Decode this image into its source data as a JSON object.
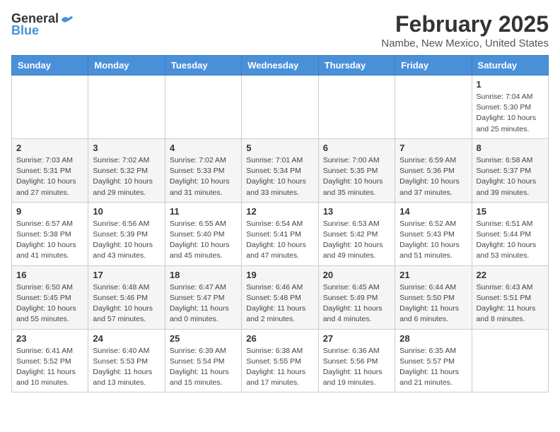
{
  "header": {
    "logo_general": "General",
    "logo_blue": "Blue",
    "title": "February 2025",
    "location": "Nambe, New Mexico, United States"
  },
  "days_of_week": [
    "Sunday",
    "Monday",
    "Tuesday",
    "Wednesday",
    "Thursday",
    "Friday",
    "Saturday"
  ],
  "weeks": [
    [
      {
        "day": "",
        "detail": ""
      },
      {
        "day": "",
        "detail": ""
      },
      {
        "day": "",
        "detail": ""
      },
      {
        "day": "",
        "detail": ""
      },
      {
        "day": "",
        "detail": ""
      },
      {
        "day": "",
        "detail": ""
      },
      {
        "day": "1",
        "detail": "Sunrise: 7:04 AM\nSunset: 5:30 PM\nDaylight: 10 hours\nand 25 minutes."
      }
    ],
    [
      {
        "day": "2",
        "detail": "Sunrise: 7:03 AM\nSunset: 5:31 PM\nDaylight: 10 hours\nand 27 minutes."
      },
      {
        "day": "3",
        "detail": "Sunrise: 7:02 AM\nSunset: 5:32 PM\nDaylight: 10 hours\nand 29 minutes."
      },
      {
        "day": "4",
        "detail": "Sunrise: 7:02 AM\nSunset: 5:33 PM\nDaylight: 10 hours\nand 31 minutes."
      },
      {
        "day": "5",
        "detail": "Sunrise: 7:01 AM\nSunset: 5:34 PM\nDaylight: 10 hours\nand 33 minutes."
      },
      {
        "day": "6",
        "detail": "Sunrise: 7:00 AM\nSunset: 5:35 PM\nDaylight: 10 hours\nand 35 minutes."
      },
      {
        "day": "7",
        "detail": "Sunrise: 6:59 AM\nSunset: 5:36 PM\nDaylight: 10 hours\nand 37 minutes."
      },
      {
        "day": "8",
        "detail": "Sunrise: 6:58 AM\nSunset: 5:37 PM\nDaylight: 10 hours\nand 39 minutes."
      }
    ],
    [
      {
        "day": "9",
        "detail": "Sunrise: 6:57 AM\nSunset: 5:38 PM\nDaylight: 10 hours\nand 41 minutes."
      },
      {
        "day": "10",
        "detail": "Sunrise: 6:56 AM\nSunset: 5:39 PM\nDaylight: 10 hours\nand 43 minutes."
      },
      {
        "day": "11",
        "detail": "Sunrise: 6:55 AM\nSunset: 5:40 PM\nDaylight: 10 hours\nand 45 minutes."
      },
      {
        "day": "12",
        "detail": "Sunrise: 6:54 AM\nSunset: 5:41 PM\nDaylight: 10 hours\nand 47 minutes."
      },
      {
        "day": "13",
        "detail": "Sunrise: 6:53 AM\nSunset: 5:42 PM\nDaylight: 10 hours\nand 49 minutes."
      },
      {
        "day": "14",
        "detail": "Sunrise: 6:52 AM\nSunset: 5:43 PM\nDaylight: 10 hours\nand 51 minutes."
      },
      {
        "day": "15",
        "detail": "Sunrise: 6:51 AM\nSunset: 5:44 PM\nDaylight: 10 hours\nand 53 minutes."
      }
    ],
    [
      {
        "day": "16",
        "detail": "Sunrise: 6:50 AM\nSunset: 5:45 PM\nDaylight: 10 hours\nand 55 minutes."
      },
      {
        "day": "17",
        "detail": "Sunrise: 6:48 AM\nSunset: 5:46 PM\nDaylight: 10 hours\nand 57 minutes."
      },
      {
        "day": "18",
        "detail": "Sunrise: 6:47 AM\nSunset: 5:47 PM\nDaylight: 11 hours\nand 0 minutes."
      },
      {
        "day": "19",
        "detail": "Sunrise: 6:46 AM\nSunset: 5:48 PM\nDaylight: 11 hours\nand 2 minutes."
      },
      {
        "day": "20",
        "detail": "Sunrise: 6:45 AM\nSunset: 5:49 PM\nDaylight: 11 hours\nand 4 minutes."
      },
      {
        "day": "21",
        "detail": "Sunrise: 6:44 AM\nSunset: 5:50 PM\nDaylight: 11 hours\nand 6 minutes."
      },
      {
        "day": "22",
        "detail": "Sunrise: 6:43 AM\nSunset: 5:51 PM\nDaylight: 11 hours\nand 8 minutes."
      }
    ],
    [
      {
        "day": "23",
        "detail": "Sunrise: 6:41 AM\nSunset: 5:52 PM\nDaylight: 11 hours\nand 10 minutes."
      },
      {
        "day": "24",
        "detail": "Sunrise: 6:40 AM\nSunset: 5:53 PM\nDaylight: 11 hours\nand 13 minutes."
      },
      {
        "day": "25",
        "detail": "Sunrise: 6:39 AM\nSunset: 5:54 PM\nDaylight: 11 hours\nand 15 minutes."
      },
      {
        "day": "26",
        "detail": "Sunrise: 6:38 AM\nSunset: 5:55 PM\nDaylight: 11 hours\nand 17 minutes."
      },
      {
        "day": "27",
        "detail": "Sunrise: 6:36 AM\nSunset: 5:56 PM\nDaylight: 11 hours\nand 19 minutes."
      },
      {
        "day": "28",
        "detail": "Sunrise: 6:35 AM\nSunset: 5:57 PM\nDaylight: 11 hours\nand 21 minutes."
      },
      {
        "day": "",
        "detail": ""
      }
    ]
  ]
}
